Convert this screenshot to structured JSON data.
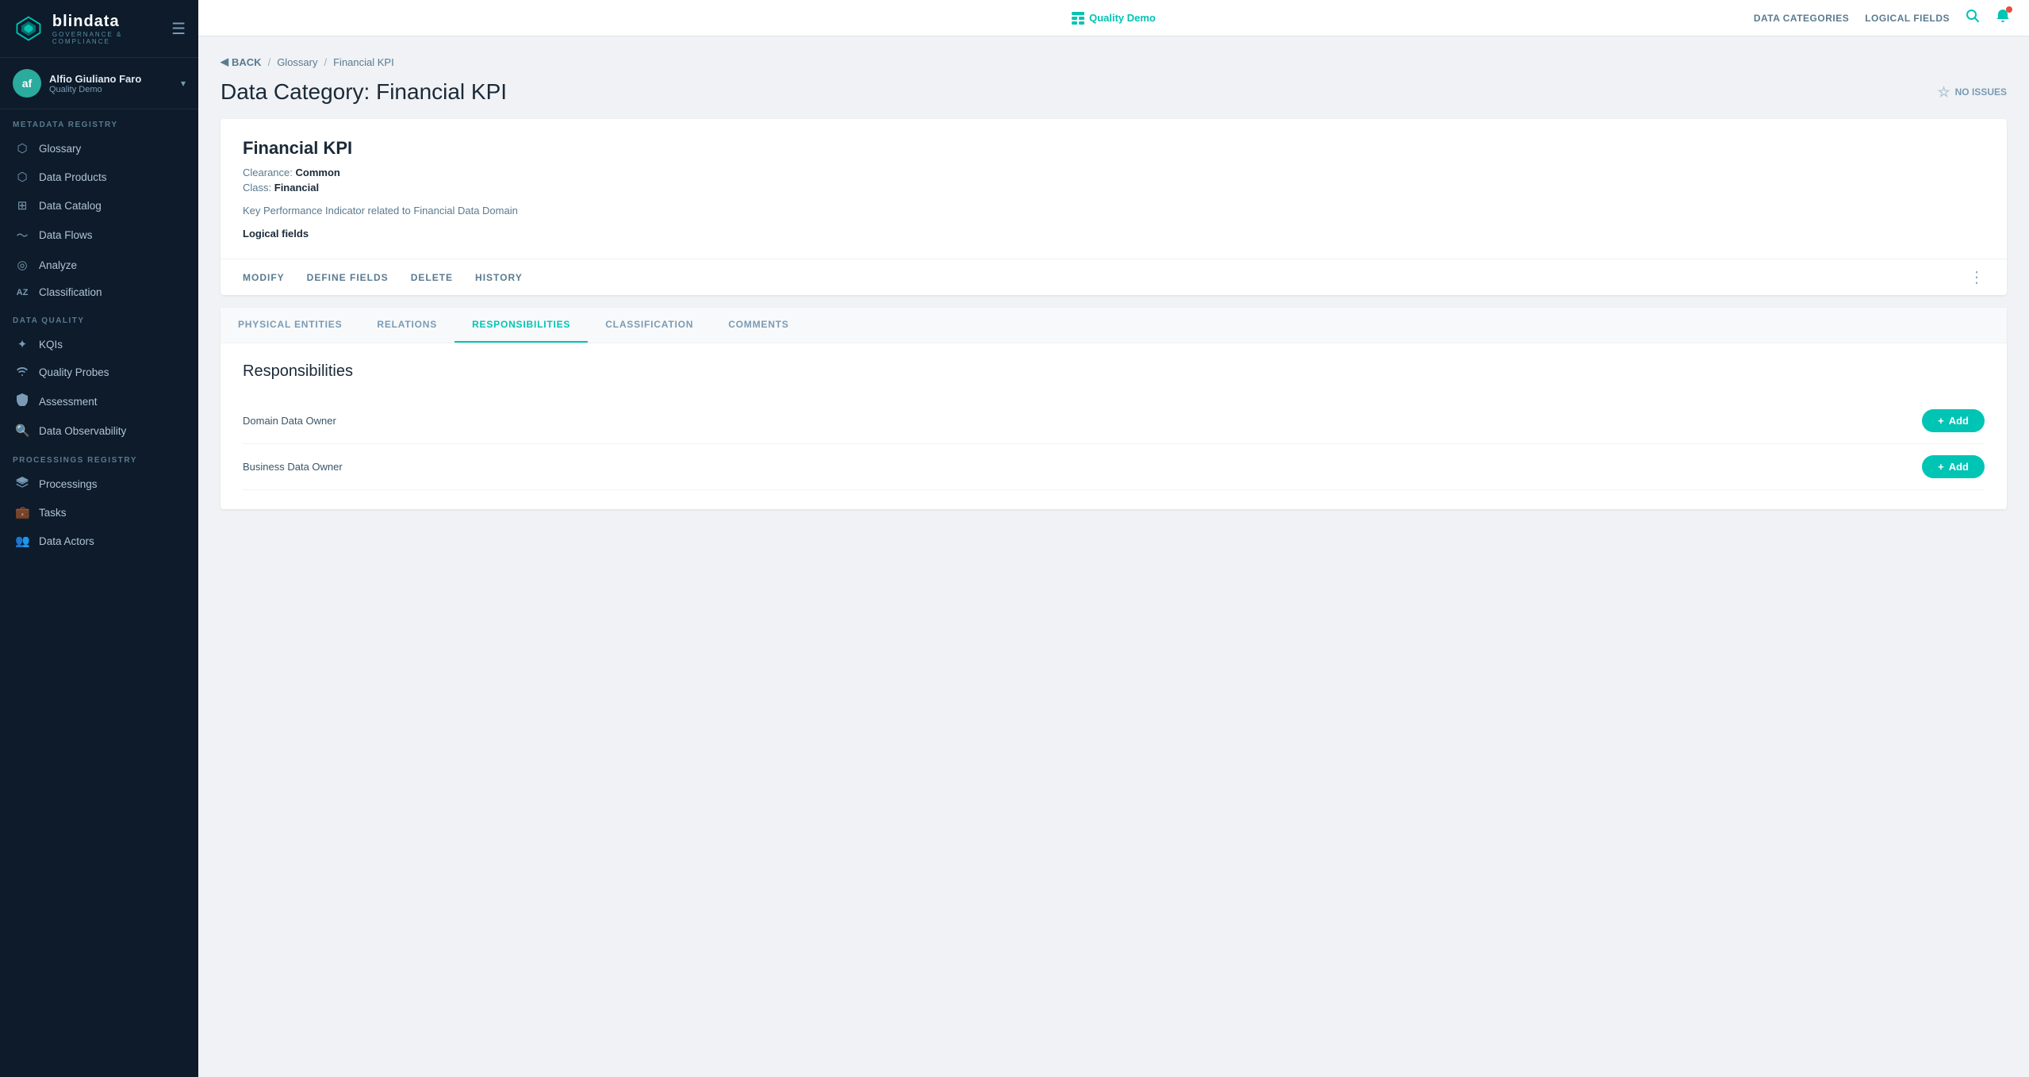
{
  "sidebar": {
    "logo": "blindata",
    "logo_sub": "GOVERNANCE & COMPLIANCE",
    "hamburger": "☰",
    "user": {
      "initials": "af",
      "name": "Alfio Giuliano Faro",
      "org": "Quality Demo"
    },
    "sections": [
      {
        "label": "METADATA REGISTRY",
        "items": [
          {
            "id": "glossary",
            "label": "Glossary",
            "icon": "puzzle"
          },
          {
            "id": "data-products",
            "label": "Data Products",
            "icon": "hexagon"
          },
          {
            "id": "data-catalog",
            "label": "Data Catalog",
            "icon": "grid"
          },
          {
            "id": "data-flows",
            "label": "Data Flows",
            "icon": "wave"
          },
          {
            "id": "analyze",
            "label": "Analyze",
            "icon": "circle-dot"
          },
          {
            "id": "classification",
            "label": "Classification",
            "icon": "az"
          }
        ]
      },
      {
        "label": "DATA QUALITY",
        "items": [
          {
            "id": "kqis",
            "label": "KQIs",
            "icon": "star-outline"
          },
          {
            "id": "quality-probes",
            "label": "Quality Probes",
            "icon": "wifi"
          },
          {
            "id": "assessment",
            "label": "Assessment",
            "icon": "shield"
          },
          {
            "id": "data-observability",
            "label": "Data Observability",
            "icon": "search-circle"
          }
        ]
      },
      {
        "label": "PROCESSINGS REGISTRY",
        "items": [
          {
            "id": "processings",
            "label": "Processings",
            "icon": "layers"
          },
          {
            "id": "tasks",
            "label": "Tasks",
            "icon": "briefcase"
          },
          {
            "id": "data-actors",
            "label": "Data Actors",
            "icon": "users"
          }
        ]
      }
    ]
  },
  "topbar": {
    "quality_demo_label": "Quality Demo",
    "data_categories_label": "DATA CATEGORIES",
    "logical_fields_label": "LOGICAL FIELDS"
  },
  "breadcrumb": {
    "back_label": "BACK",
    "glossary_label": "Glossary",
    "current_label": "Financial KPI"
  },
  "page": {
    "title": "Data Category: Financial KPI",
    "no_issues": "NO ISSUES"
  },
  "entity": {
    "title": "Financial KPI",
    "clearance_label": "Clearance:",
    "clearance_value": "Common",
    "class_label": "Class:",
    "class_value": "Financial",
    "description": "Key Performance Indicator related to Financial Data Domain",
    "logical_fields_label": "Logical fields"
  },
  "actions": {
    "modify": "MODIFY",
    "define_fields": "DEFINE FIELDS",
    "delete": "DELETE",
    "history": "HISTORY"
  },
  "tabs": [
    {
      "id": "physical-entities",
      "label": "PHYSICAL ENTITIES"
    },
    {
      "id": "relations",
      "label": "RELATIONS"
    },
    {
      "id": "responsibilities",
      "label": "RESPONSIBILITIES",
      "active": true
    },
    {
      "id": "classification",
      "label": "CLASSIFICATION"
    },
    {
      "id": "comments",
      "label": "COMMENTS"
    }
  ],
  "responsibilities": {
    "title": "Responsibilities",
    "rows": [
      {
        "label": "Domain Data Owner",
        "add_label": "Add"
      },
      {
        "label": "Business Data Owner",
        "add_label": "Add"
      }
    ]
  }
}
